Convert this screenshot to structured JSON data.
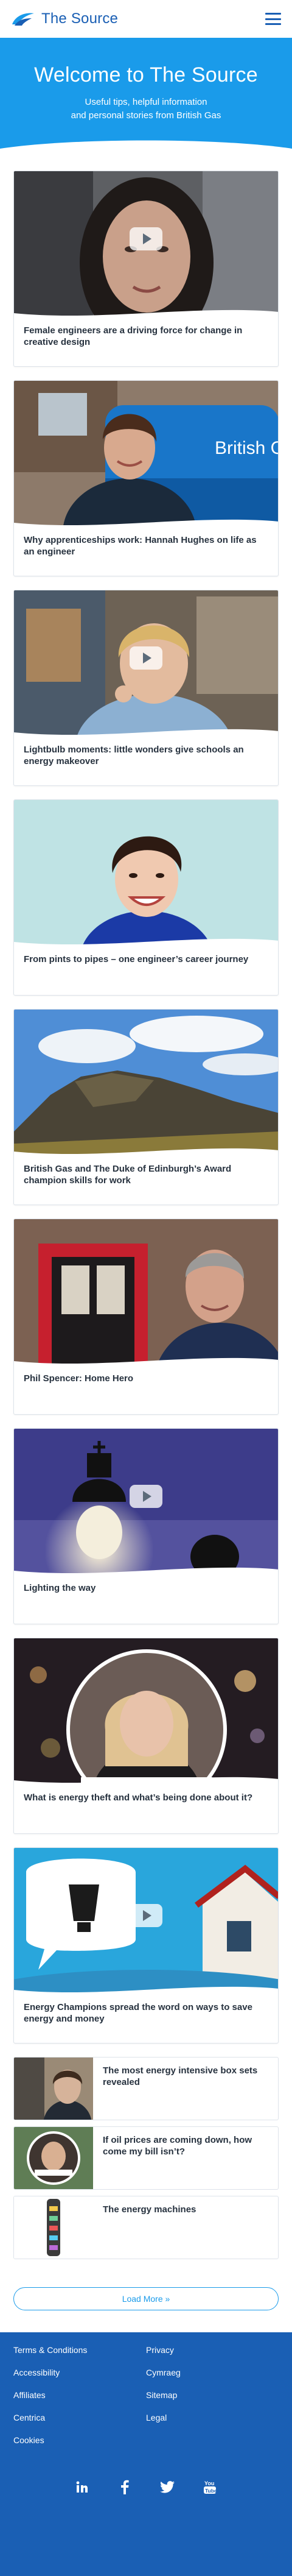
{
  "header": {
    "brand_name": "The Source",
    "logo_icon": "british-gas-flame-logo",
    "menu_icon": "hamburger-menu-icon"
  },
  "hero": {
    "title": "Welcome to The Source",
    "subtitle_line1": "Useful tips, helpful information",
    "subtitle_line2": "and personal stories from British Gas"
  },
  "articles": [
    {
      "title": "Female engineers are a driving force for change in creative design",
      "has_video": true
    },
    {
      "title": "Why apprenticeships work: Hannah Hughes on life as an engineer",
      "has_video": false,
      "image_text": "British Gas"
    },
    {
      "title": "Lightbulb moments: little wonders give schools an energy makeover",
      "has_video": true
    },
    {
      "title": "From pints to pipes – one engineer’s career journey",
      "has_video": false
    },
    {
      "title": "British Gas and The Duke of Edinburgh’s Award champion skills for work",
      "has_video": false
    },
    {
      "title": "Phil Spencer: Home Hero",
      "has_video": false
    },
    {
      "title": "Lighting the way",
      "has_video": true
    },
    {
      "title": "What is energy theft and what’s being done about it?",
      "has_video": false
    },
    {
      "title": "Energy Champions spread the word on ways to save energy and money",
      "has_video": true
    }
  ],
  "mini_articles": [
    {
      "title": "The most energy intensive box sets revealed"
    },
    {
      "title": "If oil prices are coming down, how come my bill isn’t?"
    },
    {
      "title": "The energy machines"
    }
  ],
  "load_more_label": "Load More »",
  "footer": {
    "left_links": [
      "Terms & Conditions",
      "Accessibility",
      "Affiliates",
      "Centrica",
      "Cookies"
    ],
    "right_links": [
      "Privacy",
      "Cymraeg",
      "Sitemap",
      "Legal"
    ],
    "social_icons": [
      "linkedin-icon",
      "facebook-icon",
      "twitter-icon",
      "youtube-icon"
    ]
  },
  "colors": {
    "brand_blue": "#1a5fb4",
    "hero_blue": "#1a9bea",
    "card_border": "#dde3ea"
  }
}
